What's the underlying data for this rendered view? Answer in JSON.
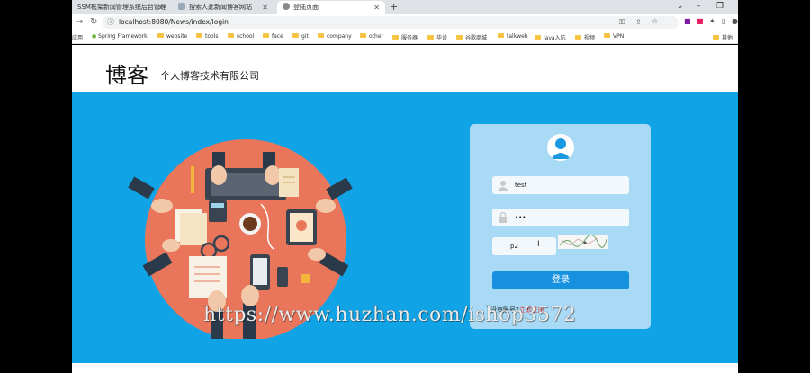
{
  "browser": {
    "tabs": [
      {
        "label": "SSM框架新闻管理系统后台管理"
      },
      {
        "label": "搜索人此新闻博客网站"
      },
      {
        "label": "登陆页面"
      }
    ],
    "url": "localhost:8080/News/index/login",
    "bookmarks": [
      "应用",
      "Spring Framework",
      "website",
      "tools",
      "school",
      "face",
      "git",
      "company",
      "other",
      "服务器",
      "毕设",
      "谷歌商城",
      "talkweb",
      "java入坑",
      "视频",
      "VPN",
      "其他"
    ]
  },
  "header": {
    "logo": "博客",
    "company": "个人博客技术有限公司"
  },
  "login": {
    "username": "test",
    "password": "•••",
    "captcha_input": "p2",
    "button_label": "登录",
    "register_prompt": "没有账号?",
    "register_link": "立即注册"
  },
  "watermark": "https://www.huzhan.com/ishop3572",
  "colors": {
    "hero_bg": "#10a3e6",
    "card_bg": "#a8d9f5",
    "button": "#1691e0",
    "register_link": "#e0353a"
  }
}
